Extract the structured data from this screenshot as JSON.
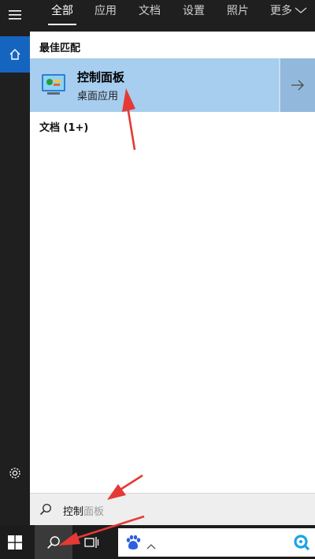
{
  "tabs": [
    {
      "label": "全部",
      "active": true
    },
    {
      "label": "应用"
    },
    {
      "label": "文档"
    },
    {
      "label": "设置"
    },
    {
      "label": "照片"
    },
    {
      "label": "更多"
    }
  ],
  "sections": {
    "best_match": "最佳匹配",
    "documents": "文档 (1+)"
  },
  "best_result": {
    "title": "控制面板",
    "subtitle": "桌面应用"
  },
  "search": {
    "typed": "控制",
    "suggestion": "面板"
  },
  "colors": {
    "accent": "#1565c0",
    "selected_row": "#a7cdef",
    "arrow_annotation": "#e53935"
  },
  "icons": [
    "hamburger-menu-icon",
    "home-icon",
    "settings-gear-icon",
    "control-panel-icon",
    "arrow-right-icon",
    "search-icon",
    "windows-logo-icon",
    "task-view-icon",
    "baidu-paw-icon",
    "chevron-up-icon",
    "q-icon"
  ]
}
